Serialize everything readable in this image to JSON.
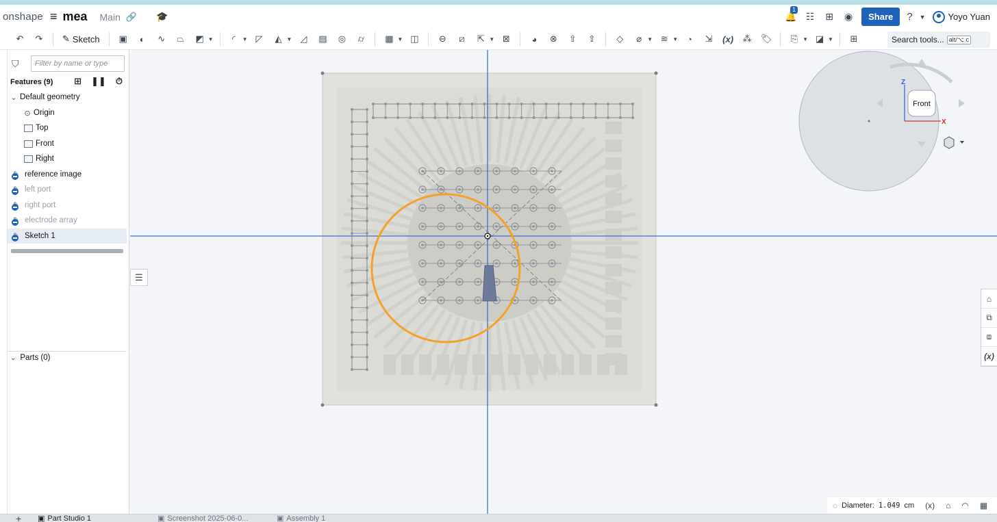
{
  "header": {
    "logo": "onshape",
    "doc_title": "mea",
    "workspace": "Main",
    "notification_count": "1",
    "share_label": "Share",
    "user_name": "Yoyo Yuan"
  },
  "toolbar": {
    "sketch_label": "Sketch",
    "search_label": "Search tools...",
    "search_shortcut": "alt/⌥ c"
  },
  "panel": {
    "filter_placeholder": "Filter by name or type",
    "features_label": "Features (9)",
    "default_geometry": "Default geometry",
    "origin": "Origin",
    "top": "Top",
    "front": "Front",
    "right": "Right",
    "items": [
      "reference image",
      "left port",
      "right port",
      "electrode array",
      "Sketch 1"
    ],
    "parts_label": "Parts (0)"
  },
  "viewcube": {
    "face_label": "Front",
    "axis_z": "Z",
    "axis_x": "X"
  },
  "status": {
    "measure_label": "Diameter:",
    "measure_value": "1.049",
    "measure_unit": "cm"
  },
  "tabs": [
    "Part Studio 1",
    "Screenshot 2025-06-0...",
    "Assembly 1"
  ],
  "colors": {
    "accent": "#1f63b8",
    "circle": "#f2a22a",
    "axis": "#3b6fd1"
  }
}
